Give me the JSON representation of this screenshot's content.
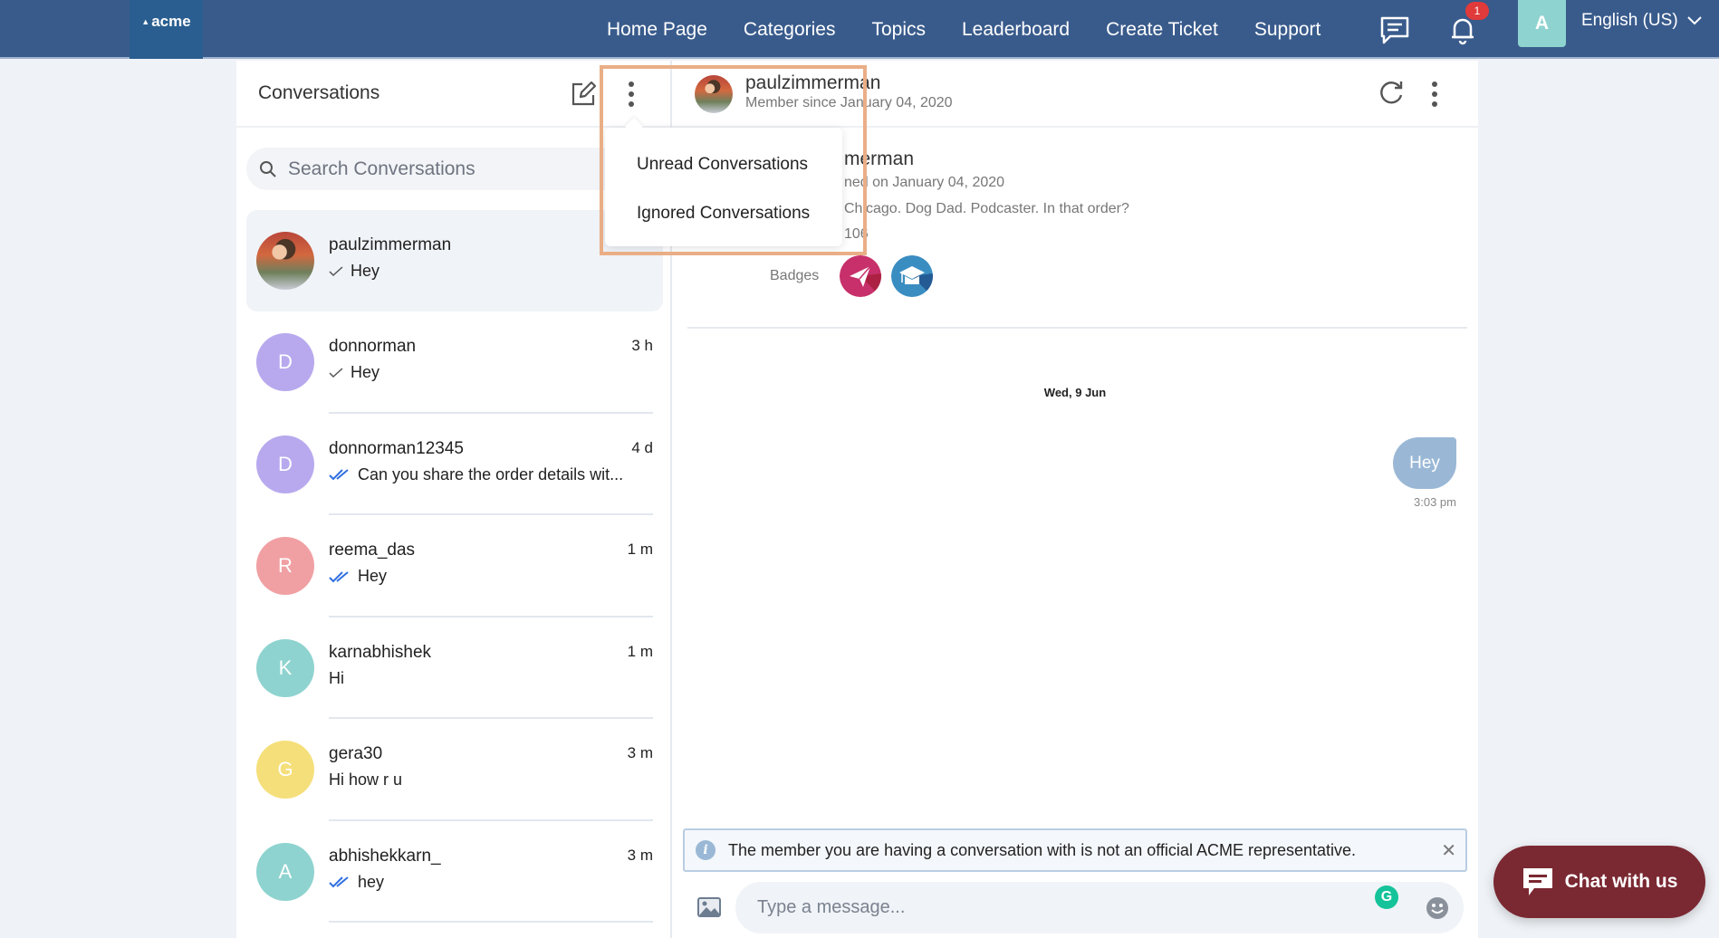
{
  "nav": {
    "logo": "acme",
    "links": [
      "Home Page",
      "Categories",
      "Topics",
      "Leaderboard",
      "Create Ticket",
      "Support"
    ],
    "notification_count": "1",
    "avatar_initial": "A",
    "language": "English (US)"
  },
  "conversations": {
    "title": "Conversations",
    "search_placeholder": "Search Conversations",
    "menu": {
      "items": [
        "Unread Conversations",
        "Ignored Conversations"
      ]
    },
    "items": [
      {
        "name": "paulzimmerman",
        "preview": "Hey",
        "time": "",
        "status": "sent",
        "avatar": "photo",
        "selected": true
      },
      {
        "name": "donnorman",
        "preview": "Hey",
        "time": "3 h",
        "status": "sent",
        "initial": "D",
        "color": "#b8a9ee"
      },
      {
        "name": "donnorman12345",
        "preview": "Can you share the order details wit...",
        "time": "4 d",
        "status": "read",
        "initial": "D",
        "color": "#b8a9ee"
      },
      {
        "name": "reema_das",
        "preview": "Hey",
        "time": "1 m",
        "status": "read",
        "initial": "R",
        "color": "#f0a0a3"
      },
      {
        "name": "karnabhishek",
        "preview": "Hi",
        "time": "1 m",
        "status": "none",
        "initial": "K",
        "color": "#8ed3cf"
      },
      {
        "name": "gera30",
        "preview": "Hi how r u",
        "time": "3 m",
        "status": "none",
        "initial": "G",
        "color": "#f5df7a"
      },
      {
        "name": "abhishekkarn_",
        "preview": "hey",
        "time": "3 m",
        "status": "read",
        "initial": "A",
        "color": "#8ed3cf"
      }
    ]
  },
  "chat": {
    "header": {
      "name": "paulzimmerman",
      "member_since": "Member since January 04, 2020"
    },
    "profile": {
      "name_fragment": "merman",
      "joined_fragment": "ned on January 04, 2020",
      "bio_fragment": "Chicago. Dog Dad. Podcaster. In that order?",
      "count_fragment": "106",
      "badges_label": "Badges",
      "badges": [
        "paper-plane-badge",
        "graduation-cap-badge"
      ]
    },
    "date_separator": "Wed, 9 Jun",
    "messages": [
      {
        "text": "Hey",
        "time": "3:03 pm",
        "direction": "outgoing"
      }
    ],
    "notice": "The member you are having a conversation with is not an official ACME representative.",
    "composer_placeholder": "Type a message...",
    "grammarly": "G"
  },
  "widget": {
    "label": "Chat with us"
  },
  "colors": {
    "nav_bg": "#395b8c",
    "logo_bg": "#2a5e90",
    "bubble": "#9ab8d6",
    "read_check": "#2f6fe0",
    "widget_bg": "#7a2832",
    "highlight": "#eaae86"
  }
}
